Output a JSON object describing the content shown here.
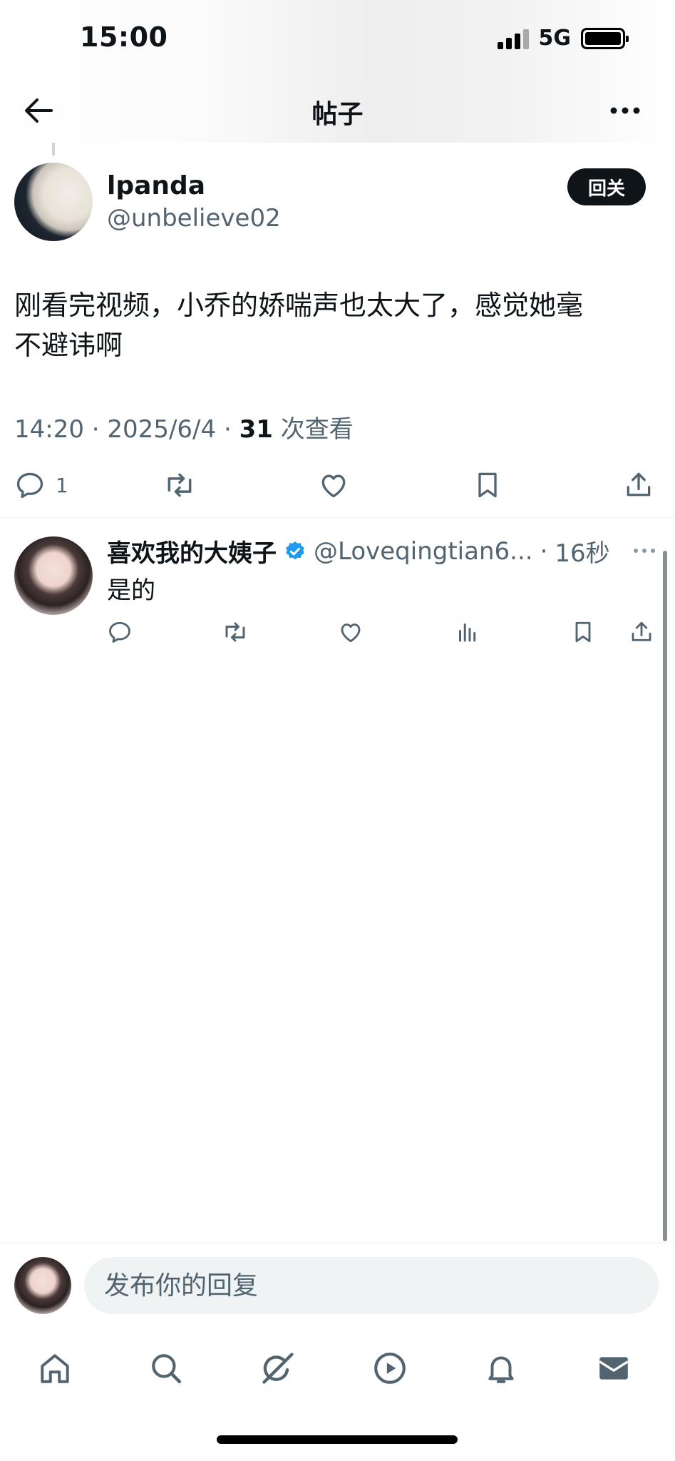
{
  "status_bar": {
    "time": "15:00",
    "network": "5G"
  },
  "header": {
    "title": "帖子"
  },
  "post": {
    "author_name": "lpanda",
    "author_handle": "@unbelieve02",
    "follow_label": "回关",
    "text_line1": "刚看完视频，小乔的娇喘声也太大了，感觉她毫",
    "text_line2": "不避讳啊",
    "time": "14:20",
    "date": "2025/6/4",
    "views_count": "31",
    "views_label": "次查看",
    "reply_count": "1"
  },
  "reply": {
    "name": "喜欢我的大姨子",
    "handle": "@Loveqingtian6...",
    "time": "16秒",
    "text": "是的"
  },
  "composer": {
    "placeholder": "发布你的回复"
  },
  "icons": {
    "back": "arrow-left-icon",
    "more": "more-horizontal-icon",
    "reply": "comment-icon",
    "repost": "repost-icon",
    "like": "heart-icon",
    "bookmark": "bookmark-icon",
    "share": "share-icon",
    "views": "bar-chart-icon",
    "verified": "verified-badge-icon",
    "nav": [
      "home-icon",
      "search-icon",
      "grok-icon",
      "video-icon",
      "bell-icon",
      "mail-icon"
    ]
  },
  "colors": {
    "text": "#0f1419",
    "muted": "#536471",
    "verified": "#1d9bf0",
    "input_bg": "#eff3f4"
  }
}
